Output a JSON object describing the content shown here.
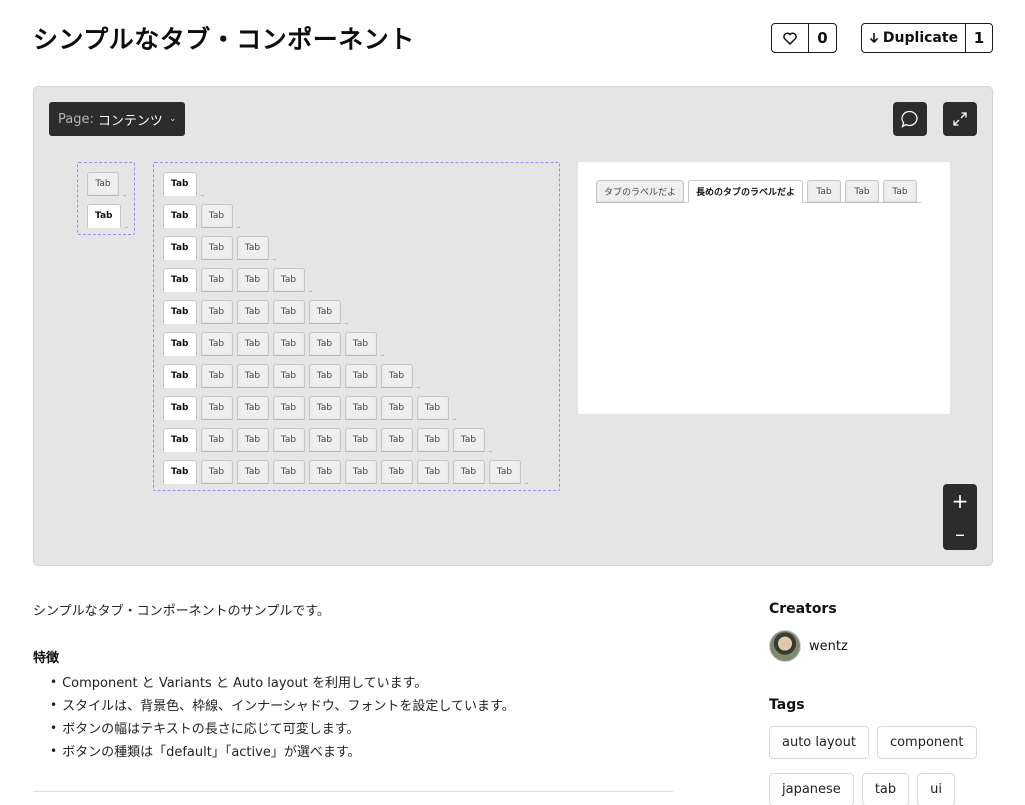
{
  "header": {
    "title": "シンプルなタブ・コンポーネント",
    "like_count": "0",
    "duplicate_label": "Duplicate",
    "duplicate_count": "1"
  },
  "canvas": {
    "page_prefix": "Page:",
    "page_name": "コンテンツ",
    "comment_icon": "speech-bubble-icon",
    "expand_icon": "expand-arrows-icon",
    "zoom_in": "+",
    "zoom_out": "–"
  },
  "preview": {
    "variant_tabs": [
      "Tab",
      "Tab"
    ],
    "tab_label": "Tab",
    "long_tabs": [
      "タブのラベルだよ",
      "長めのタブのラベルだよ",
      "Tab",
      "Tab",
      "Tab"
    ],
    "long_tabs_active_index": 1
  },
  "description": {
    "intro": "シンプルなタブ・コンポーネントのサンプルです。",
    "features_heading": "特徴",
    "features": [
      "Component と Variants と Auto layout を利用しています。",
      "スタイルは、背景色、枠線、インナーシャドウ、フォントを設定しています。",
      "ボタンの幅はテキストの長さに応じて可変します。",
      "ボタンの種類は「default」「active」が選べます。"
    ]
  },
  "sidebar": {
    "creators_heading": "Creators",
    "creator_name": "wentz",
    "tags_heading": "Tags",
    "tags": [
      "auto layout",
      "component",
      "japanese",
      "tab",
      "ui"
    ]
  },
  "colors": {
    "canvas_bg": "#e5e5e5",
    "frame_dash": "#9b8cf2",
    "dark_control": "#2c2c2c"
  }
}
